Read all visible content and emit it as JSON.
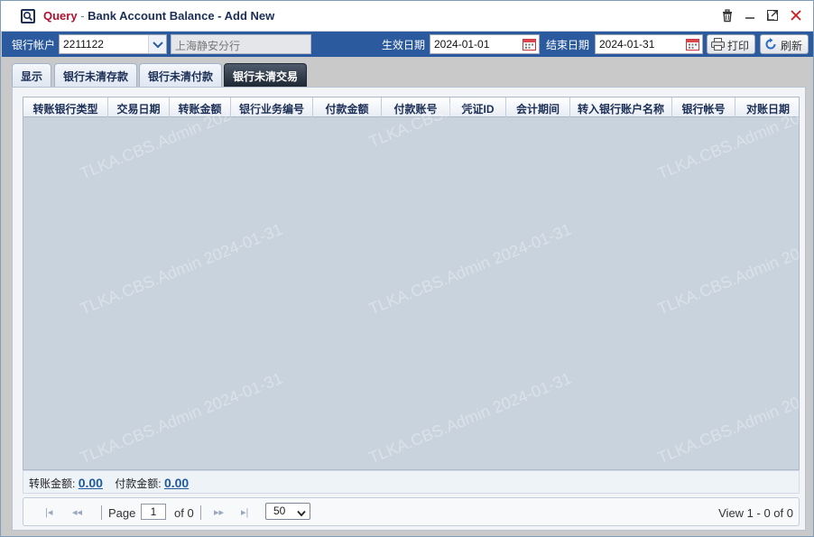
{
  "title": {
    "query": "Query",
    "separator": "-",
    "main": "Bank Account Balance - Add New"
  },
  "toolbar": {
    "account_label": "银行帐户",
    "account_value": "2211122",
    "branch_value": "上海静安分行",
    "start_label": "生效日期",
    "start_value": "2024-01-01",
    "end_label": "结束日期",
    "end_value": "2024-01-31",
    "print_label": "打印",
    "refresh_label": "刷新"
  },
  "tabs": [
    {
      "label": "显示"
    },
    {
      "label": "银行未清存款"
    },
    {
      "label": "银行未清付款"
    },
    {
      "label": "银行未清交易"
    }
  ],
  "grid": {
    "columns": [
      {
        "label": "转账银行类型"
      },
      {
        "label": "交易日期"
      },
      {
        "label": "转账金额"
      },
      {
        "label": "银行业务编号"
      },
      {
        "label": "付款金额"
      },
      {
        "label": "付款账号"
      },
      {
        "label": "凭证ID"
      },
      {
        "label": "会计期间"
      },
      {
        "label": "转入银行账户名称"
      },
      {
        "label": "银行帐号"
      },
      {
        "label": "对账日期"
      }
    ],
    "watermark": "TLKA.CBS.Admin 2024-01-31"
  },
  "summary": {
    "transfer_label": "转账金额:",
    "transfer_value": "0.00",
    "payment_label": "付款金额:",
    "payment_value": "0.00"
  },
  "pager": {
    "page_label": "Page",
    "page_value": "1",
    "of_label": "of 0",
    "page_size": "50",
    "view_text": "View 1 - 0 of 0"
  },
  "colors": {
    "toolbar": "#2b5b9e",
    "title_query": "#b2102f",
    "title_main": "#1b2e55",
    "active_tab": "#1e2733",
    "grid_body": "#c9d3de"
  }
}
